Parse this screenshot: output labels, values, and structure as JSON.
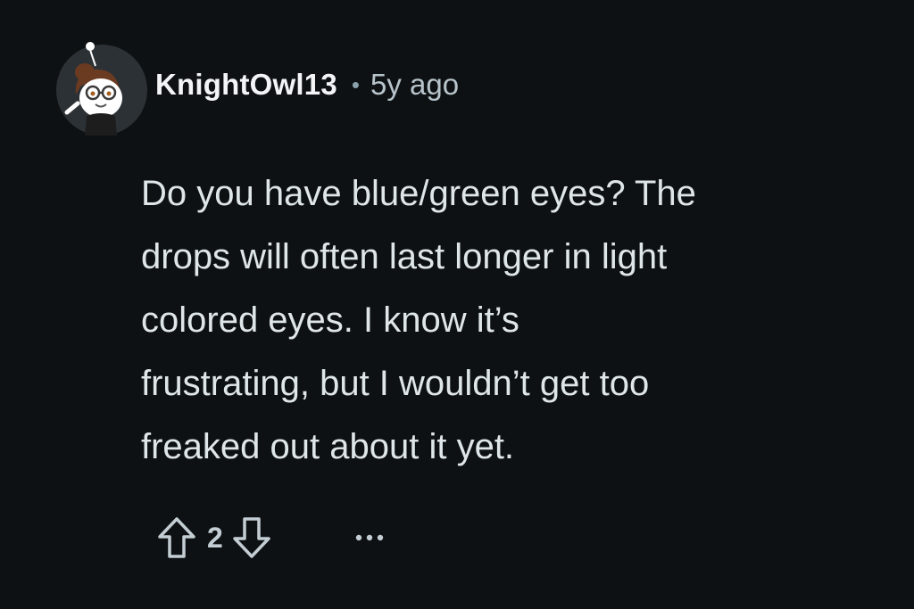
{
  "comment": {
    "username": "KnightOwl13",
    "separator": "•",
    "age": "5y ago",
    "body": "Do you have blue/green eyes? The\ndrops will often last longer in light\ncolored eyes. I know it’s\nfrustrating, but I wouldn’t get too\nfreaked out about it yet.",
    "score": "2"
  },
  "icons": {
    "avatar": "snoo-avatar",
    "upvote": "upvote-arrow-icon",
    "downvote": "downvote-arrow-icon",
    "more": "more-options-icon"
  },
  "colors": {
    "background": "#0e1113",
    "text": "#dfe6ea",
    "meta": "#b7c4cb",
    "icon": "#c3ced4"
  }
}
